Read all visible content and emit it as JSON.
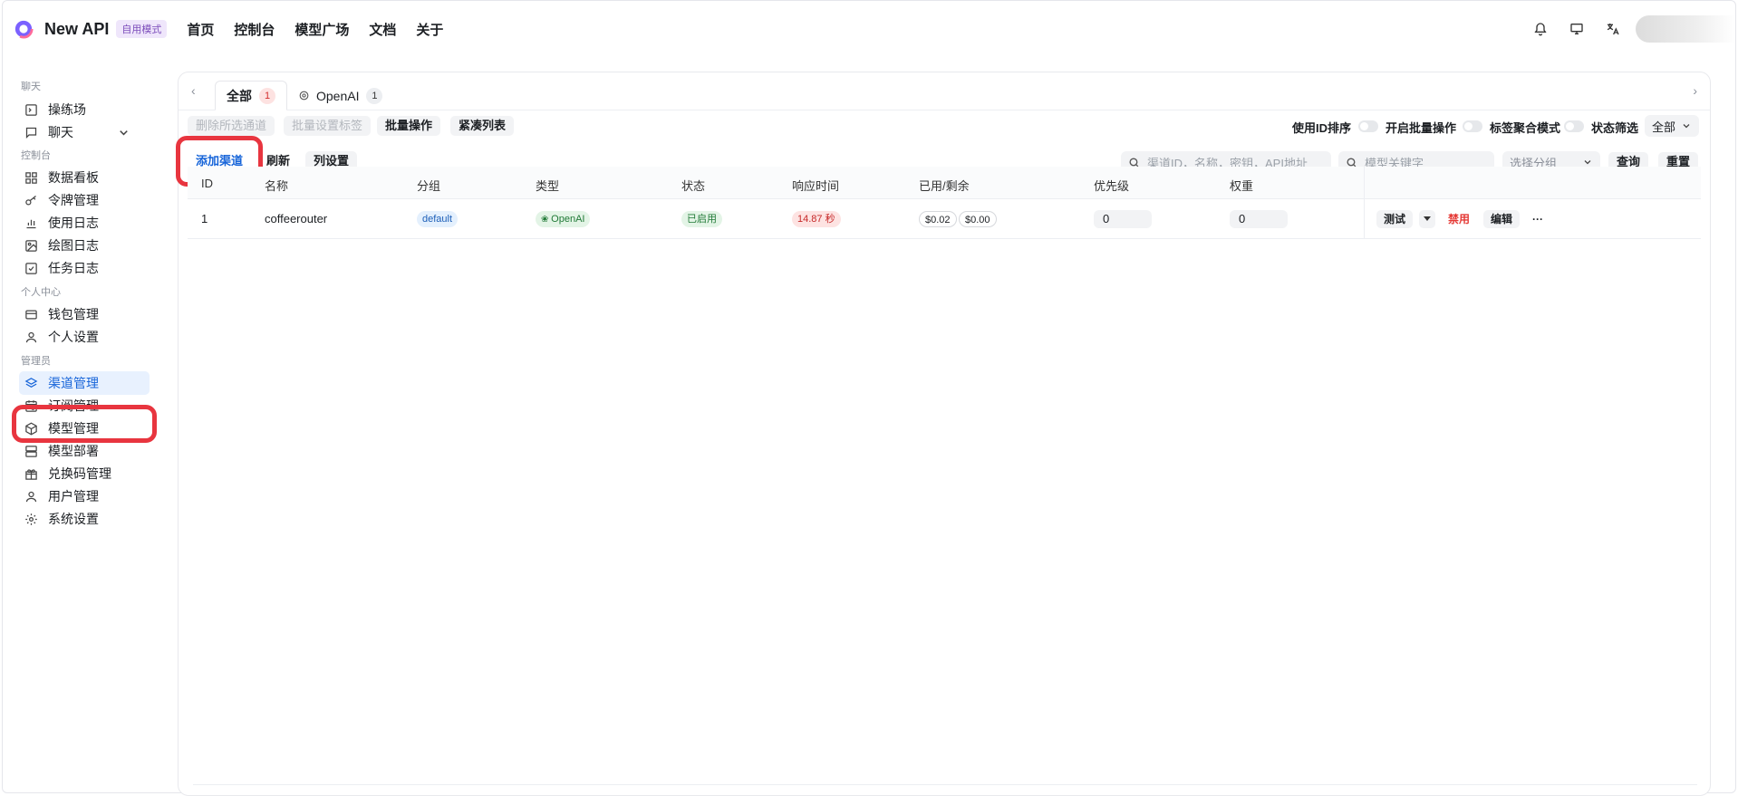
{
  "header": {
    "app_title": "New API",
    "mode_badge": "自用模式",
    "nav": [
      "首页",
      "控制台",
      "模型广场",
      "文档",
      "关于"
    ],
    "icons": [
      "bell-icon",
      "monitor-icon",
      "translate-icon"
    ]
  },
  "sidebar": {
    "groups": {
      "chat": "聊天",
      "console": "控制台",
      "personal": "个人中心",
      "admin": "管理员"
    },
    "items": {
      "playground": "操练场",
      "chat": "聊天",
      "dashboard": "数据看板",
      "tokens": "令牌管理",
      "usage_log": "使用日志",
      "drawing_log": "绘图日志",
      "task_log": "任务日志",
      "wallet": "钱包管理",
      "personal_settings": "个人设置",
      "channels": "渠道管理",
      "subscriptions": "订阅管理",
      "models": "模型管理",
      "deployments": "模型部署",
      "redemption": "兑换码管理",
      "users": "用户管理",
      "system_settings": "系统设置"
    },
    "active_item": "channels"
  },
  "tabs": [
    {
      "label": "全部",
      "count": "1"
    },
    {
      "label": "OpenAI",
      "count": "1"
    }
  ],
  "toolbar1": {
    "delete_selected": "删除所选通道",
    "batch_tag": "批量设置标签",
    "batch_ops": "批量操作",
    "compact_list": "紧凑列表",
    "sort_by_id": "使用ID排序",
    "enable_batch": "开启批量操作",
    "tag_aggregate": "标签聚合模式",
    "status_filter": "状态筛选",
    "status_value": "全部"
  },
  "toolbar2": {
    "add_channel": "添加渠道",
    "refresh": "刷新",
    "column_settings": "列设置",
    "search_placeholder": "渠道ID，名称，密钥，API地址",
    "model_placeholder": "模型关键字",
    "group_placeholder": "选择分组",
    "query": "查询",
    "reset": "重置"
  },
  "table": {
    "columns": [
      "ID",
      "名称",
      "分组",
      "类型",
      "状态",
      "响应时间",
      "已用/剩余",
      "优先级",
      "权重"
    ],
    "rows": [
      {
        "id": "1",
        "name": "coffeerouter",
        "group": "default",
        "type": "OpenAI",
        "status": "已启用",
        "response_time": "14.87 秒",
        "used": "$0.02",
        "remaining": "$0.00",
        "priority": "0",
        "weight": "0",
        "actions": {
          "test": "测试",
          "disable": "禁用",
          "edit": "编辑",
          "more": "···"
        }
      }
    ]
  },
  "colors": {
    "accent": "#1664d9",
    "highlight": "#e8353f",
    "danger": "#e53935"
  }
}
